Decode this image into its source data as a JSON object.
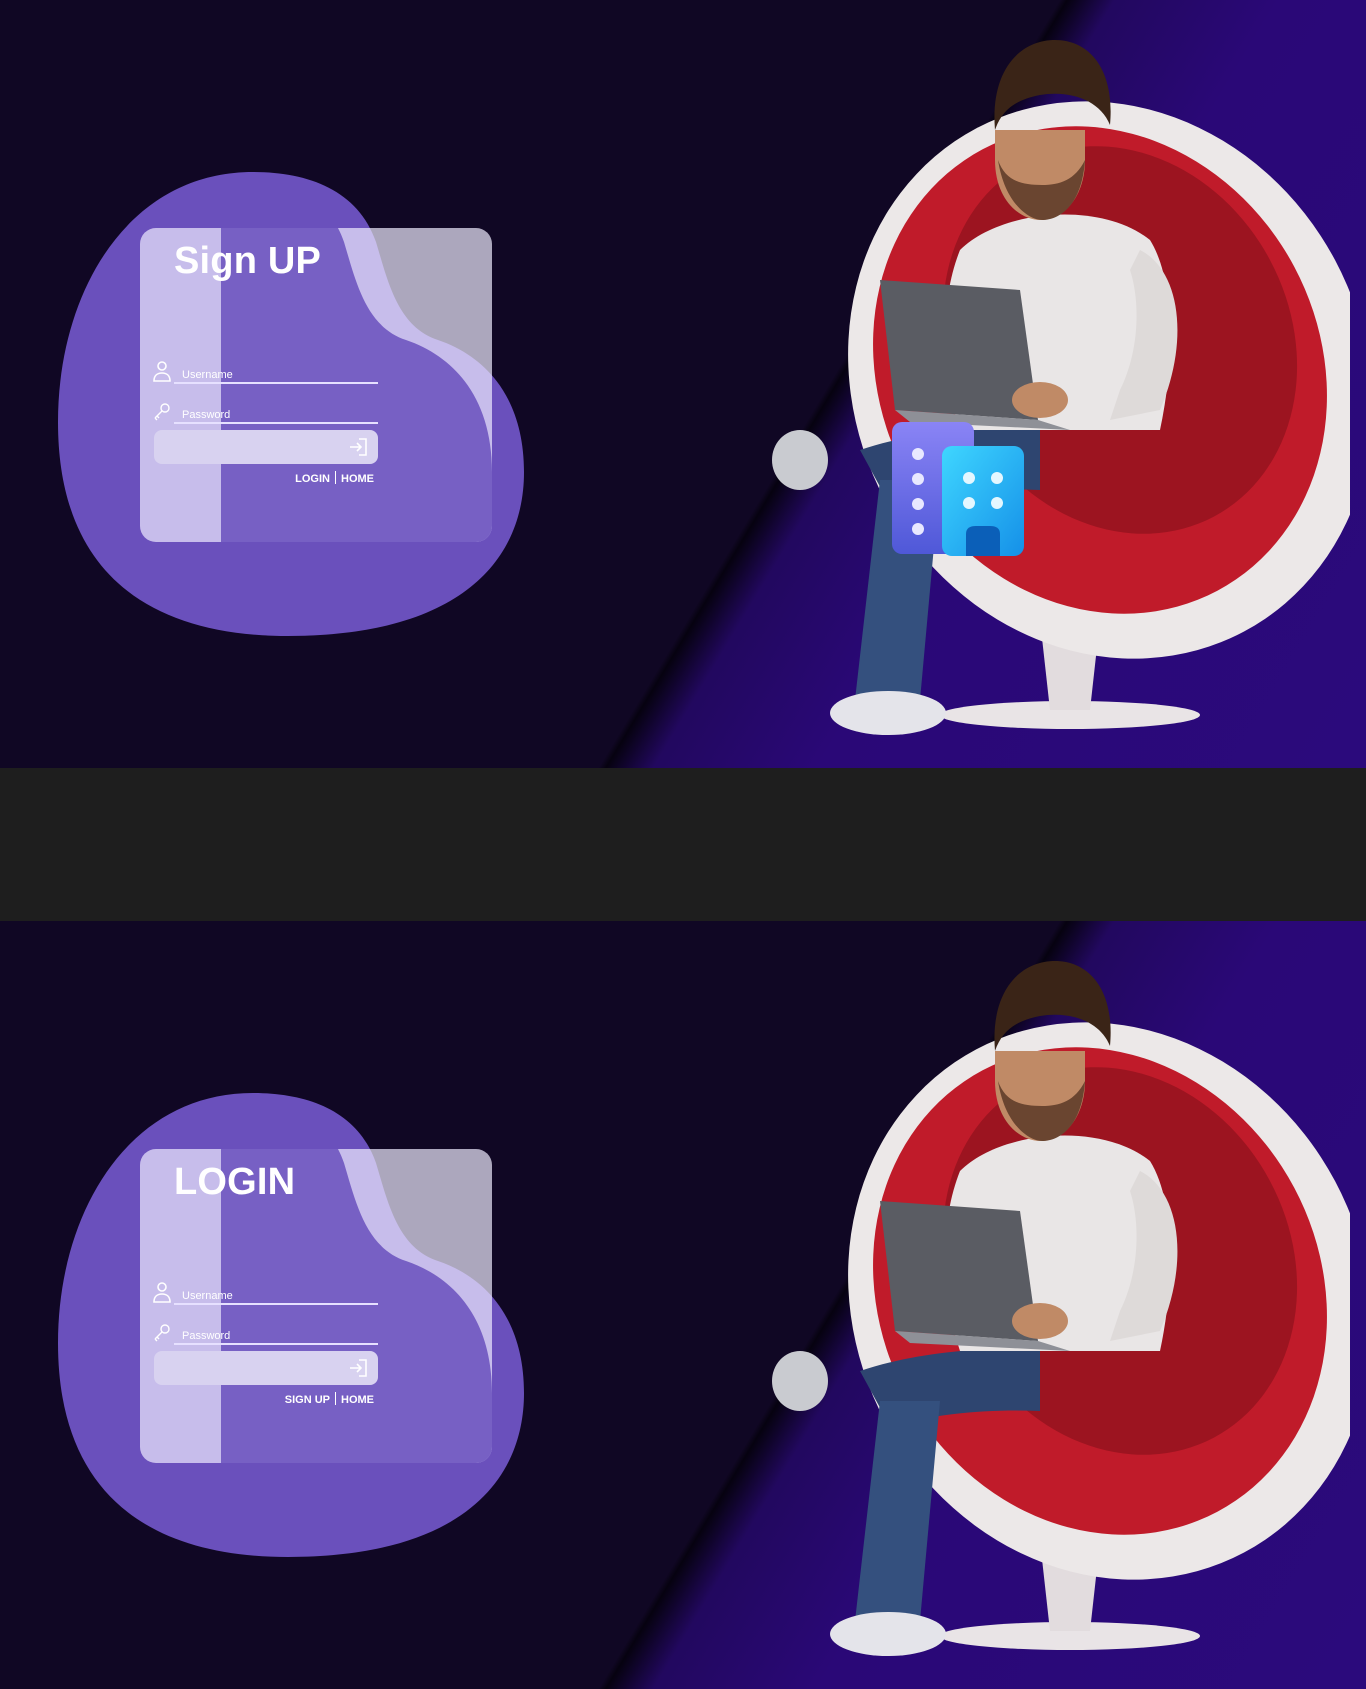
{
  "signup": {
    "title": "Sign UP",
    "username_label": "Username",
    "password_label": "Password",
    "link_primary": "LOGIN",
    "link_secondary": "HOME"
  },
  "login": {
    "title": "LOGIN",
    "username_label": "Username",
    "password_label": "Password",
    "link_primary": "SIGN UP",
    "link_secondary": "HOME"
  },
  "icons": {
    "user": "user-icon",
    "key": "key-icon",
    "submit": "login-arrow-icon",
    "app": "building-icon"
  },
  "colors": {
    "background_dark": "#100724",
    "background_purple": "#2b0a7c",
    "blob": "#6a50bc",
    "panel": "#b3b0c2",
    "button": "#d8d2f0",
    "chair_red": "#c01b2a"
  }
}
